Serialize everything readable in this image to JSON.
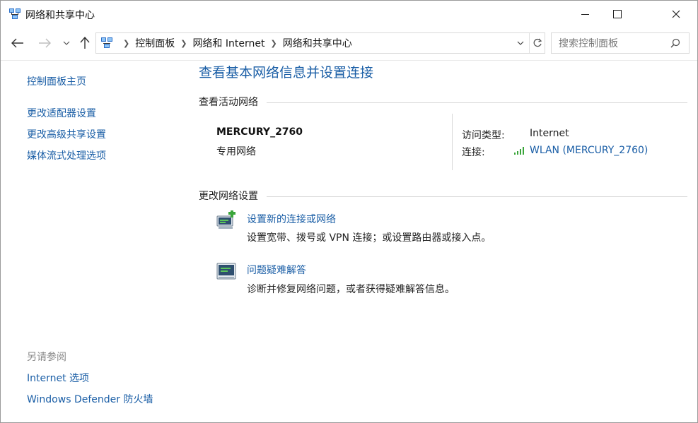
{
  "window": {
    "title": "网络和共享中心",
    "icon": "network-center-icon"
  },
  "nav": {
    "back_icon": "back-arrow-icon",
    "forward_icon": "forward-arrow-icon",
    "recent_icon": "chevron-down-icon",
    "up_icon": "up-arrow-icon"
  },
  "address": {
    "crumbs": [
      "控制面板",
      "网络和 Internet",
      "网络和共享中心"
    ]
  },
  "search": {
    "placeholder": "搜索控制面板"
  },
  "sidebar": {
    "home": "控制面板主页",
    "links": [
      "更改适配器设置",
      "更改高级共享设置",
      "媒体流式处理选项"
    ],
    "see_also_title": "另请参阅",
    "see_also": [
      "Internet 选项",
      "Windows Defender 防火墙"
    ]
  },
  "main": {
    "title": "查看基本网络信息并设置连接",
    "active_title": "查看活动网络",
    "network": {
      "name": "MERCURY_2760",
      "type": "专用网络",
      "access_label": "访问类型:",
      "access_value": "Internet",
      "conn_label": "连接:",
      "conn_value": "WLAN (MERCURY_2760)"
    },
    "change_title": "更改网络设置",
    "tasks": [
      {
        "link": "设置新的连接或网络",
        "desc": "设置宽带、拨号或 VPN 连接；或设置路由器或接入点。",
        "icon": "new-connection-icon"
      },
      {
        "link": "问题疑难解答",
        "desc": "诊断并修复网络问题，或者获得疑难解答信息。",
        "icon": "troubleshoot-icon"
      }
    ]
  },
  "colors": {
    "link": "#1a5ea6",
    "signal": "#3aa53a"
  }
}
